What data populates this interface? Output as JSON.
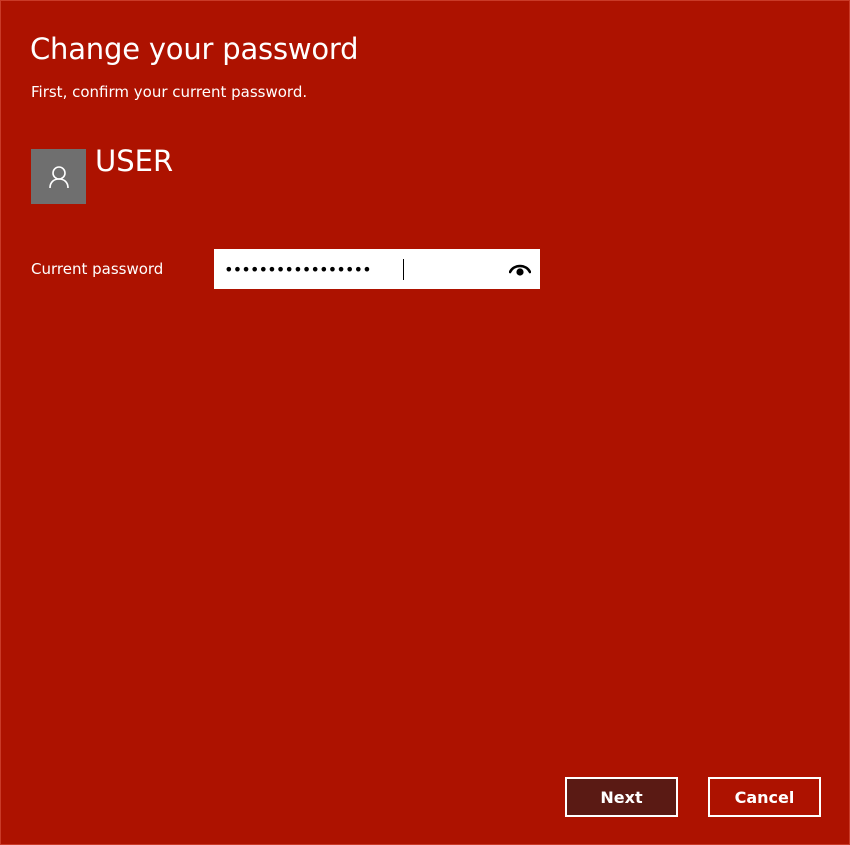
{
  "dialog": {
    "title": "Change your password",
    "subtitle": "First, confirm your current password."
  },
  "user": {
    "name": "USER",
    "avatar_icon": "person-icon"
  },
  "password_field": {
    "label": "Current password",
    "value": "•••••••••••••••••",
    "reveal_icon": "eye-icon"
  },
  "buttons": {
    "next_label": "Next",
    "cancel_label": "Cancel"
  },
  "colors": {
    "background": "#ad1200",
    "primary_button": "#5a1a14",
    "avatar": "#6f6f6f"
  }
}
